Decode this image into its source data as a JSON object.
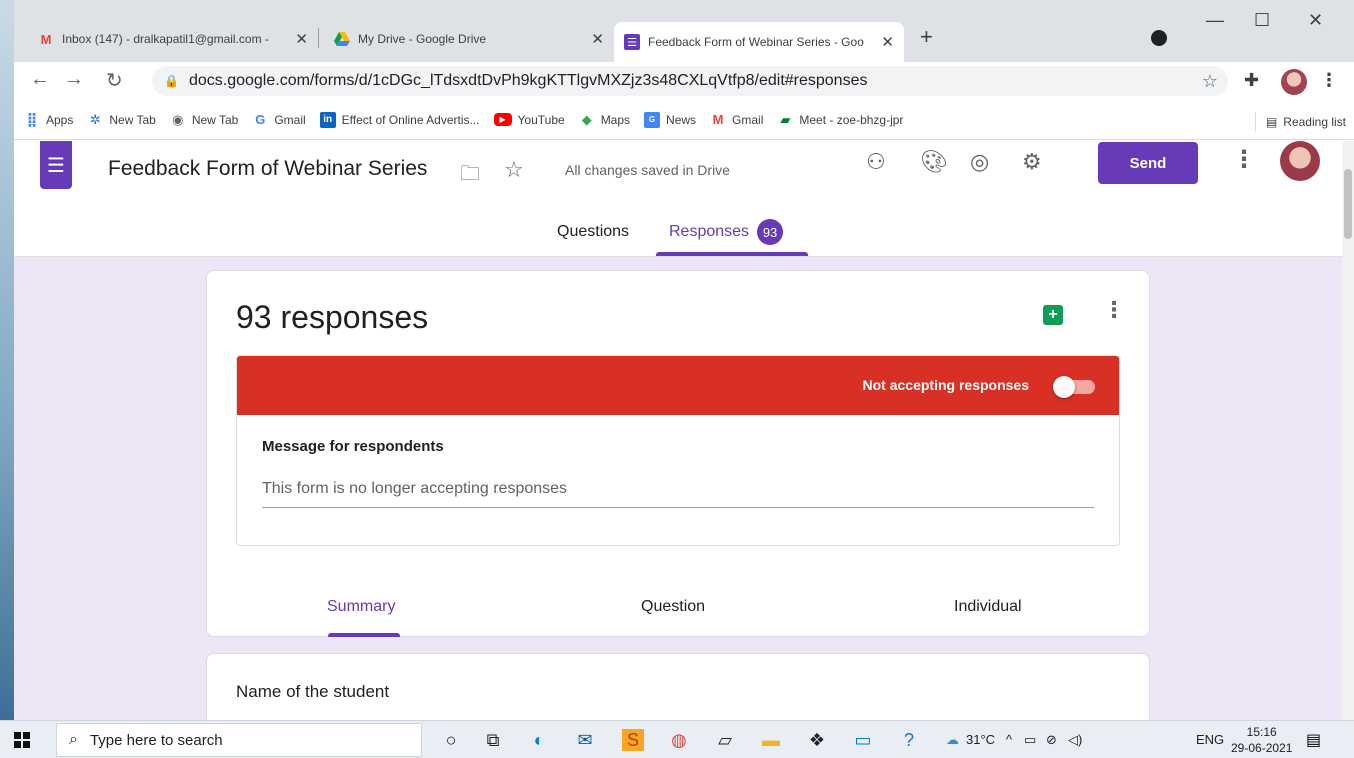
{
  "browser": {
    "tabs": [
      {
        "title": "Inbox (147) - dralkapatil1@gmail.com -",
        "icon": "gmail-icon"
      },
      {
        "title": "My Drive - Google Drive",
        "icon": "drive-icon"
      },
      {
        "title": "Feedback Form of Webinar Series - Goo",
        "icon": "forms-icon",
        "active": true
      }
    ],
    "url": "docs.google.com/forms/d/1cDGc_lTdsxdtDvPh9kgKTTlgvMXZjz3s48CXLqVtfp8/edit#responses",
    "bookmarks": [
      {
        "label": "Apps",
        "icon": "apps-grid-icon"
      },
      {
        "label": "New Tab",
        "icon": "gear-icon"
      },
      {
        "label": "New Tab",
        "icon": "globe-icon"
      },
      {
        "label": "Gmail",
        "icon": "google-icon"
      },
      {
        "label": "Effect of Online Advertis...",
        "icon": "linkedin-icon"
      },
      {
        "label": "YouTube",
        "icon": "youtube-icon"
      },
      {
        "label": "Maps",
        "icon": "maps-icon"
      },
      {
        "label": "News",
        "icon": "news-icon"
      },
      {
        "label": "Gmail",
        "icon": "gmail-icon"
      },
      {
        "label": "Meet - zoe-bhzg-jpr",
        "icon": "meet-icon"
      }
    ],
    "reading_list": "Reading list"
  },
  "form": {
    "title": "Feedback Form of Webinar Series",
    "save_status": "All changes saved in Drive",
    "send_label": "Send",
    "tabs": {
      "questions": "Questions",
      "responses": "Responses",
      "responses_count": "93"
    }
  },
  "responses": {
    "count_label": "93 responses",
    "accepting_label": "Not accepting responses",
    "accepting": false,
    "message_label": "Message for respondents",
    "message_value": "This form is no longer accepting responses",
    "subtabs": [
      "Summary",
      "Question",
      "Individual"
    ],
    "first_question": "Name of the student"
  },
  "taskbar": {
    "search_placeholder": "Type here to search",
    "weather": "31°C",
    "lang": "ENG",
    "time": "15:16",
    "date": "29-06-2021"
  },
  "colors": {
    "accent": "#673ab7",
    "alert": "#d93025",
    "background": "#ece6f6"
  }
}
